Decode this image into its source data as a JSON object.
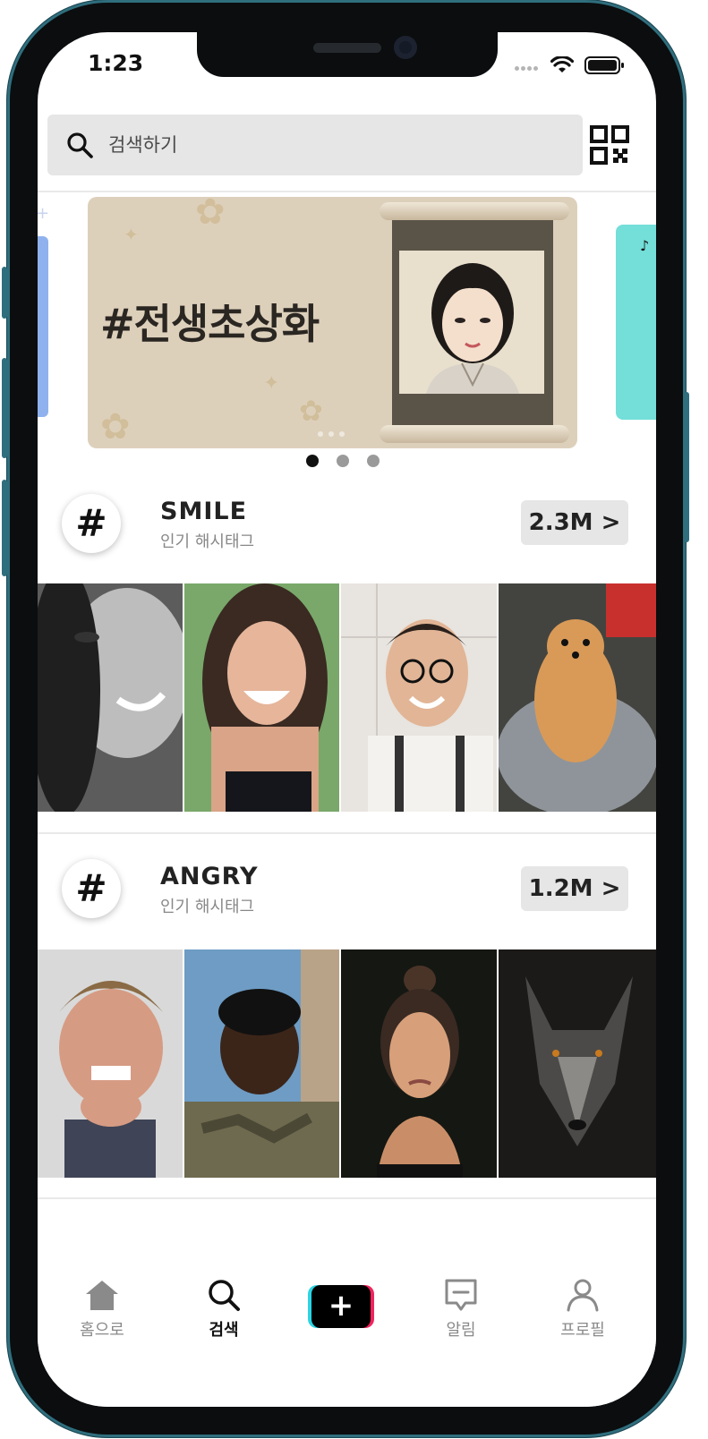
{
  "status": {
    "time": "1:23"
  },
  "search": {
    "placeholder": "검색하기"
  },
  "banner": {
    "title": "#전생초상화",
    "pages": 3,
    "active_page": 0
  },
  "hashtags": [
    {
      "tag": "SMILE",
      "subtitle": "인기 해시태그",
      "count": "2.3M >"
    },
    {
      "tag": "ANGRY",
      "subtitle": "인기 해시태그",
      "count": "1.2M >"
    }
  ],
  "tabbar": {
    "items": [
      {
        "label": "홈으로"
      },
      {
        "label": "검색",
        "active": true
      },
      {
        "label": ""
      },
      {
        "label": "알림"
      },
      {
        "label": "프로필"
      }
    ]
  },
  "colors": {
    "accent_cyan": "#2bd5e3",
    "accent_pink": "#f0245d",
    "frame": "#2f6e7d"
  }
}
